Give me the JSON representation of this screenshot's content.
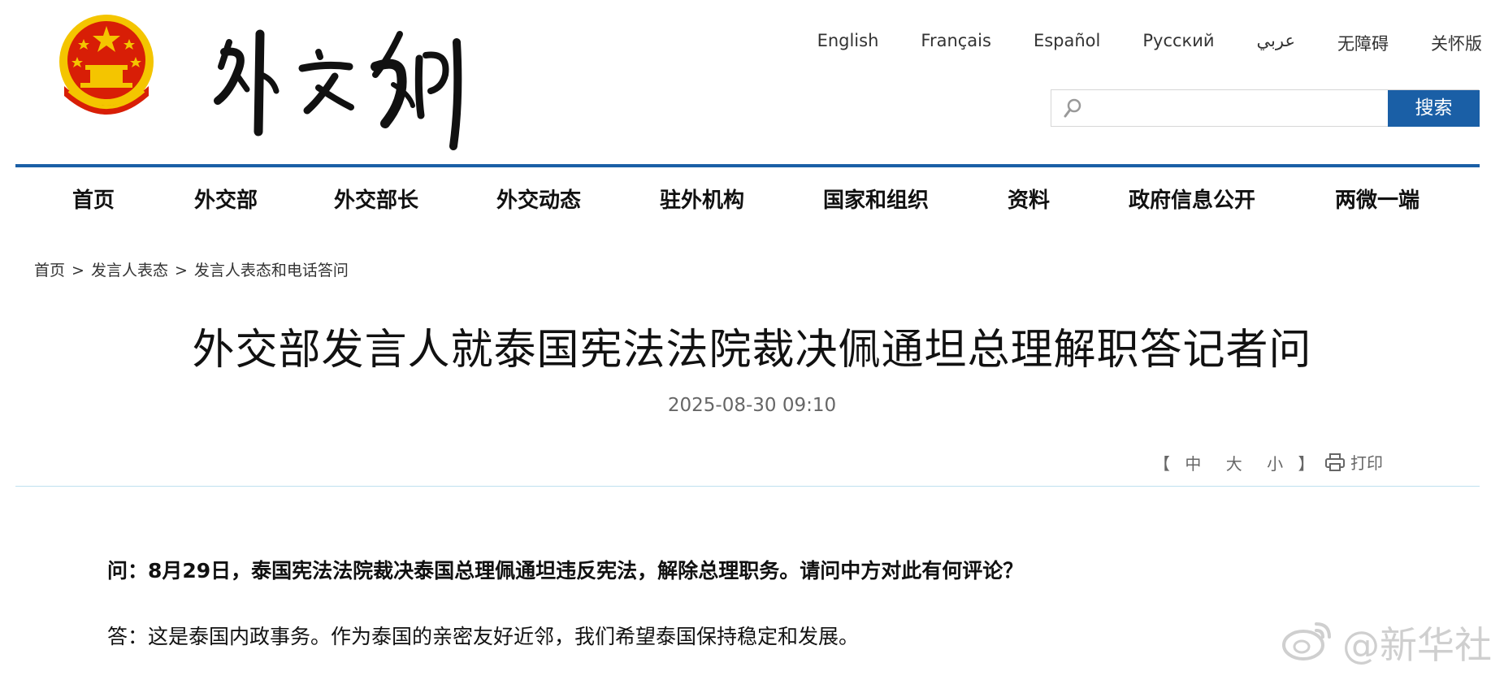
{
  "site": {
    "brand_colors": {
      "primary": "#1a5fa6",
      "emblem_red": "#d81e06",
      "emblem_gold": "#f4c500"
    },
    "languages": [
      "English",
      "Français",
      "Español",
      "Русский",
      "عربي",
      "无障碍",
      "关怀版"
    ],
    "search": {
      "placeholder": "",
      "button_label": "搜索",
      "icon": "search-icon"
    }
  },
  "nav": {
    "items": [
      "首页",
      "外交部",
      "外交部长",
      "外交动态",
      "驻外机构",
      "国家和组织",
      "资料",
      "政府信息公开",
      "两微一端"
    ]
  },
  "breadcrumb": {
    "items": [
      "首页",
      "发言人表态",
      "发言人表态和电话答问"
    ],
    "separator": ">"
  },
  "article": {
    "title": "外交部发言人就泰国宪法法院裁决佩通坦总理解职答记者问",
    "date": "2025-08-30 09:10",
    "font_size": {
      "open": "【",
      "options": [
        "中",
        "大",
        "小"
      ],
      "close": "】"
    },
    "print_label": "打印",
    "question": "问：8月29日，泰国宪法法院裁决泰国总理佩通坦违反宪法，解除总理职务。请问中方对此有何评论？",
    "answer": "答：这是泰国内政事务。作为泰国的亲密友好近邻，我们希望泰国保持稳定和发展。"
  },
  "watermark": {
    "text": "@新华社",
    "icon": "weibo-icon"
  }
}
